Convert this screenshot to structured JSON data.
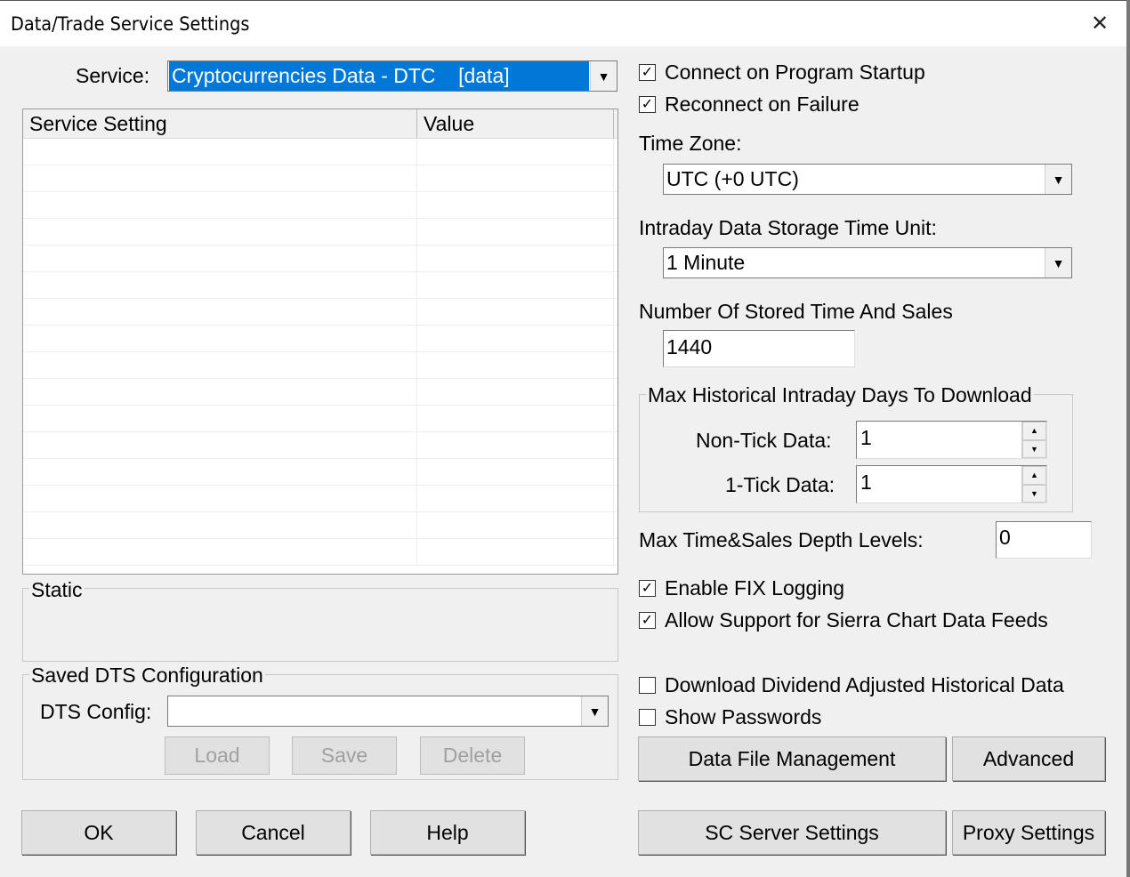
{
  "window": {
    "title": "Data/Trade Service Settings",
    "close": "✕"
  },
  "service": {
    "label": "Service:",
    "value": "Cryptocurrencies Data - DTC    [data]"
  },
  "table": {
    "columns": [
      "Service Setting",
      "Value"
    ],
    "row_count": 16
  },
  "static": {
    "label": "Static"
  },
  "saved_dts": {
    "label": "Saved DTS Configuration",
    "config_label": "DTS Config:",
    "config_value": "",
    "load": "Load",
    "save": "Save",
    "delete": "Delete"
  },
  "buttons": {
    "ok": "OK",
    "cancel": "Cancel",
    "help": "Help",
    "data_file_management": "Data File Management",
    "advanced": "Advanced",
    "sc_server_settings": "SC Server Settings",
    "proxy_settings": "Proxy Settings"
  },
  "options": {
    "connect_on_startup": {
      "label": "Connect on Program Startup",
      "checked": true
    },
    "reconnect_on_failure": {
      "label": "Reconnect on Failure",
      "checked": true
    },
    "enable_fix_logging": {
      "label": "Enable FIX Logging",
      "checked": true
    },
    "allow_sierra_feeds": {
      "label": "Allow Support for Sierra Chart Data Feeds",
      "checked": true
    },
    "download_dividend": {
      "label": "Download Dividend Adjusted Historical Data",
      "checked": false
    },
    "show_passwords": {
      "label": "Show Passwords",
      "checked": false
    }
  },
  "time_zone": {
    "label": "Time Zone:",
    "value": "UTC (+0 UTC)"
  },
  "storage_unit": {
    "label": "Intraday Data Storage Time Unit:",
    "value": "1 Minute"
  },
  "stored_ts": {
    "label": "Number Of Stored Time And Sales",
    "value": "1440"
  },
  "max_days": {
    "label": "Max Historical Intraday Days To Download",
    "non_tick_label": "Non-Tick Data:",
    "non_tick_value": "1",
    "tick_label": "1-Tick Data:",
    "tick_value": "1"
  },
  "depth": {
    "label": "Max Time&Sales Depth Levels:",
    "value": "0"
  }
}
